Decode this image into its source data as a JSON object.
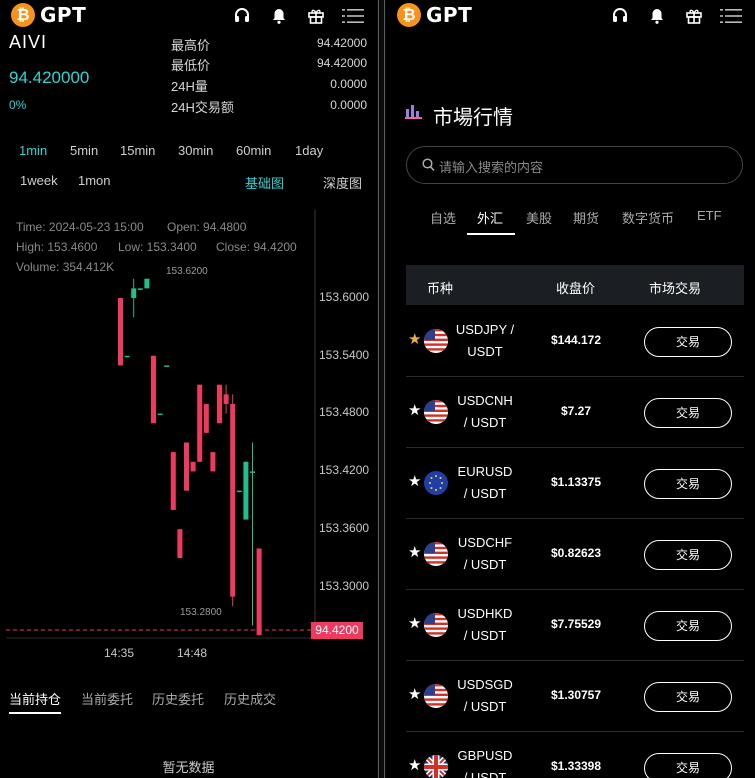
{
  "brand": {
    "name": "GPT",
    "coin_glyph": "₿",
    "coin_color": "#f7931a"
  },
  "left": {
    "symbol": "AIVI",
    "last_price": "94.420000",
    "change_pct": "0%",
    "stats": [
      {
        "label": "最高价",
        "value": "94.42000"
      },
      {
        "label": "最低价",
        "value": "94.42000"
      },
      {
        "label": "24H量",
        "value": "0.0000"
      },
      {
        "label": "24H交易额",
        "value": "0.0000"
      }
    ],
    "timeframes": [
      "1min",
      "5min",
      "15min",
      "30min",
      "60min",
      "1day",
      "1week",
      "1mon"
    ],
    "active_timeframe": "1min",
    "chart_modes": {
      "basic": "基础图",
      "depth": "深度图"
    },
    "ohlc": {
      "time": "Time: 2024-05-23 15:00",
      "open": "Open: 94.4800",
      "high": "High: 153.4600",
      "low": "Low: 153.3400",
      "close": "Close: 94.4200",
      "volume": "Volume: 354.412K"
    },
    "order_tabs": [
      "当前持仓",
      "当前委托",
      "历史委托",
      "历史成交"
    ],
    "empty_text": "暂无数据"
  },
  "chart_data": {
    "type": "candlestick",
    "y_ticks": [
      "153.6000",
      "153.5400",
      "153.4800",
      "153.4200",
      "153.3600",
      "153.3000"
    ],
    "ylim": [
      153.25,
      153.65
    ],
    "x_ticks": [
      "14:35",
      "14:48"
    ],
    "max_marker": "153.6200",
    "min_marker": "153.2800",
    "current_price_label": "94.4200",
    "up_color": "#1fbf8f",
    "down_color": "#ef3a60",
    "candles": [
      {
        "o": 153.6,
        "h": 153.6,
        "l": 153.53,
        "c": 153.53
      },
      {
        "o": 153.54,
        "h": 153.54,
        "l": 153.54,
        "c": 153.54
      },
      {
        "o": 153.6,
        "h": 153.62,
        "l": 153.58,
        "c": 153.61
      },
      {
        "o": 153.61,
        "h": 153.61,
        "l": 153.61,
        "c": 153.61
      },
      {
        "o": 153.61,
        "h": 153.62,
        "l": 153.61,
        "c": 153.62
      },
      {
        "o": 153.54,
        "h": 153.54,
        "l": 153.47,
        "c": 153.47
      },
      {
        "o": 153.48,
        "h": 153.48,
        "l": 153.48,
        "c": 153.48
      },
      {
        "o": 153.53,
        "h": 153.53,
        "l": 153.53,
        "c": 153.53
      },
      {
        "o": 153.44,
        "h": 153.44,
        "l": 153.38,
        "c": 153.38
      },
      {
        "o": 153.36,
        "h": 153.36,
        "l": 153.33,
        "c": 153.33
      },
      {
        "o": 153.45,
        "h": 153.45,
        "l": 153.4,
        "c": 153.4
      },
      {
        "o": 153.43,
        "h": 153.43,
        "l": 153.42,
        "c": 153.42
      },
      {
        "o": 153.51,
        "h": 153.51,
        "l": 153.43,
        "c": 153.43
      },
      {
        "o": 153.49,
        "h": 153.49,
        "l": 153.46,
        "c": 153.46
      },
      {
        "o": 153.44,
        "h": 153.44,
        "l": 153.42,
        "c": 153.42
      },
      {
        "o": 153.51,
        "h": 153.51,
        "l": 153.47,
        "c": 153.47
      },
      {
        "o": 153.5,
        "h": 153.51,
        "l": 153.48,
        "c": 153.49
      },
      {
        "o": 153.49,
        "h": 153.5,
        "l": 153.28,
        "c": 153.29
      },
      {
        "o": 153.4,
        "h": 153.4,
        "l": 153.4,
        "c": 153.4
      },
      {
        "o": 153.37,
        "h": 153.43,
        "l": 153.37,
        "c": 153.43
      },
      {
        "o": 153.42,
        "h": 153.45,
        "l": 153.26,
        "c": 153.42
      },
      {
        "o": 153.34,
        "h": 153.34,
        "l": 153.25,
        "c": 153.25
      }
    ]
  },
  "right": {
    "title": "市場行情",
    "search_placeholder": "请输入搜索的内容",
    "categories": [
      "自选",
      "外汇",
      "美股",
      "期货",
      "数字货币",
      "ETF"
    ],
    "active_category": "外汇",
    "headers": {
      "pair": "币种",
      "price": "收盘价",
      "action": "市场交易"
    },
    "trade_label": "交易",
    "rows": [
      {
        "base": "USDJPY /",
        "quote": "USDT",
        "price": "$144.172",
        "starred": true,
        "flag": "us"
      },
      {
        "base": "USDCNH",
        "quote": "/ USDT",
        "price": "$7.27",
        "starred": false,
        "flag": "us"
      },
      {
        "base": "EURUSD",
        "quote": "/ USDT",
        "price": "$1.13375",
        "starred": false,
        "flag": "eu"
      },
      {
        "base": "USDCHF",
        "quote": "/ USDT",
        "price": "$0.82623",
        "starred": false,
        "flag": "us"
      },
      {
        "base": "USDHKD",
        "quote": "/ USDT",
        "price": "$7.75529",
        "starred": false,
        "flag": "us"
      },
      {
        "base": "USDSGD",
        "quote": "/ USDT",
        "price": "$1.30757",
        "starred": false,
        "flag": "us"
      },
      {
        "base": "GBPUSD",
        "quote": "/ USDT",
        "price": "$1.33398",
        "starred": false,
        "flag": "gb"
      }
    ]
  },
  "icons": [
    "headset-icon",
    "bell-icon",
    "gift-icon",
    "menu-icon",
    "search-icon",
    "market-chart-icon",
    "star-icon"
  ]
}
